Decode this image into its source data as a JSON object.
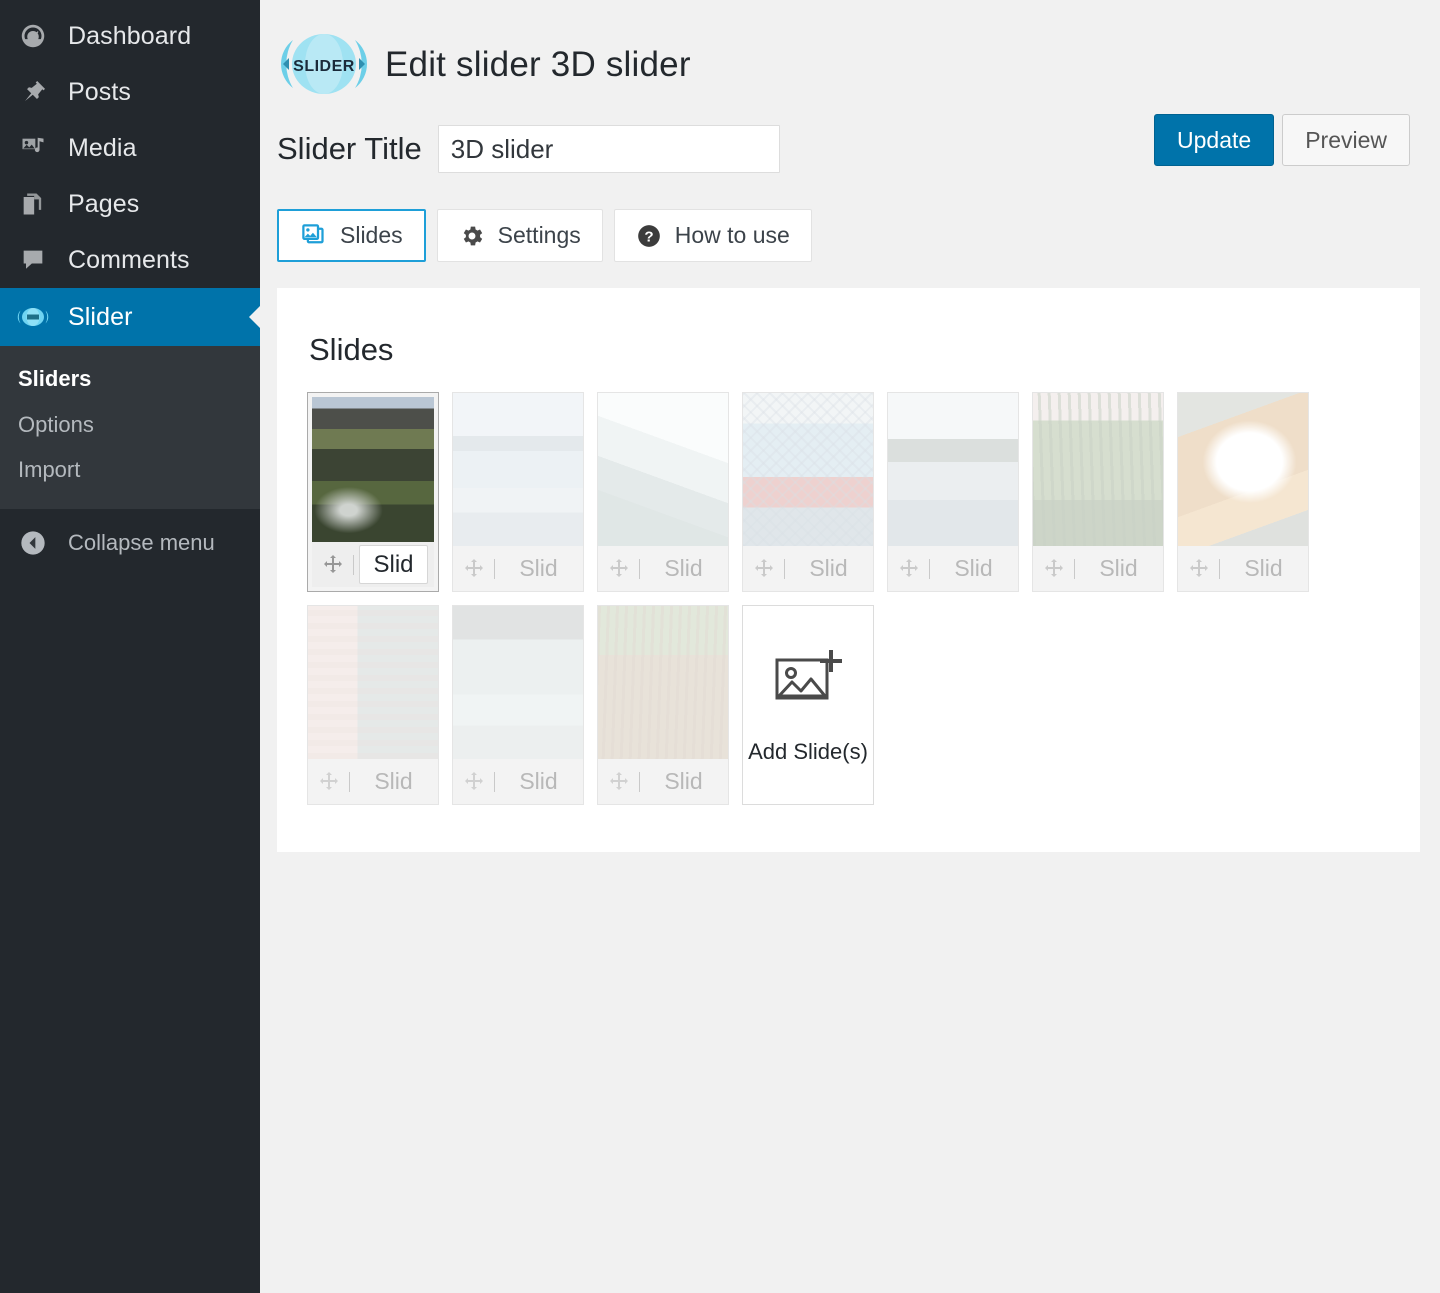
{
  "sidebar": {
    "items": [
      {
        "label": "Dashboard",
        "icon": "dashboard-icon"
      },
      {
        "label": "Posts",
        "icon": "pin-icon"
      },
      {
        "label": "Media",
        "icon": "media-icon"
      },
      {
        "label": "Pages",
        "icon": "pages-icon"
      },
      {
        "label": "Comments",
        "icon": "comments-icon"
      },
      {
        "label": "Slider",
        "icon": "slider-icon",
        "current": true
      }
    ],
    "submenu": [
      {
        "label": "Sliders",
        "active": true
      },
      {
        "label": "Options",
        "active": false
      },
      {
        "label": "Import",
        "active": false
      }
    ],
    "collapse_label": "Collapse menu",
    "collapse_icon": "collapse-arrow-icon",
    "bg": "#23282d",
    "submenu_bg": "#32373c",
    "current_bg": "#0073aa"
  },
  "header": {
    "logo_text": "SLIDER",
    "logo_icon": "slider-logo-icon",
    "title": "Edit slider 3D slider"
  },
  "title_row": {
    "label": "Slider Title",
    "value": "3D slider",
    "placeholder": "Slider title"
  },
  "actions": {
    "update_label": "Update",
    "preview_label": "Preview",
    "primary_color": "#0073aa"
  },
  "tabs": [
    {
      "label": "Slides",
      "icon": "images-stack-icon",
      "active": true
    },
    {
      "label": "Settings",
      "icon": "gear-icon",
      "active": false
    },
    {
      "label": "How to use",
      "icon": "question-circle-icon",
      "active": false
    }
  ],
  "panel": {
    "heading": "Slides",
    "slides": [
      {
        "name": "Slid",
        "selected": true,
        "thumb": "ph1",
        "fade": "none"
      },
      {
        "name": "Slid",
        "selected": false,
        "thumb": "ph2",
        "fade": "faded"
      },
      {
        "name": "Slid",
        "selected": false,
        "thumb": "ph3",
        "fade": "faded"
      },
      {
        "name": "Slid",
        "selected": false,
        "thumb": "ph4",
        "fade": "faded"
      },
      {
        "name": "Slid",
        "selected": false,
        "thumb": "ph5",
        "fade": "faded"
      },
      {
        "name": "Slid",
        "selected": false,
        "thumb": "ph6",
        "fade": "faded"
      },
      {
        "name": "Slid",
        "selected": false,
        "thumb": "ph7",
        "fade": "faded"
      },
      {
        "name": "Slid",
        "selected": false,
        "thumb": "ph8",
        "fade": "faded2"
      },
      {
        "name": "Slid",
        "selected": false,
        "thumb": "ph9",
        "fade": "faded2"
      },
      {
        "name": "Slid",
        "selected": false,
        "thumb": "ph10",
        "fade": "faded2"
      }
    ],
    "add_slide": {
      "label": "Add Slide(s)",
      "icon": "image-plus-icon"
    },
    "move_icon": "move-cross-icon"
  }
}
